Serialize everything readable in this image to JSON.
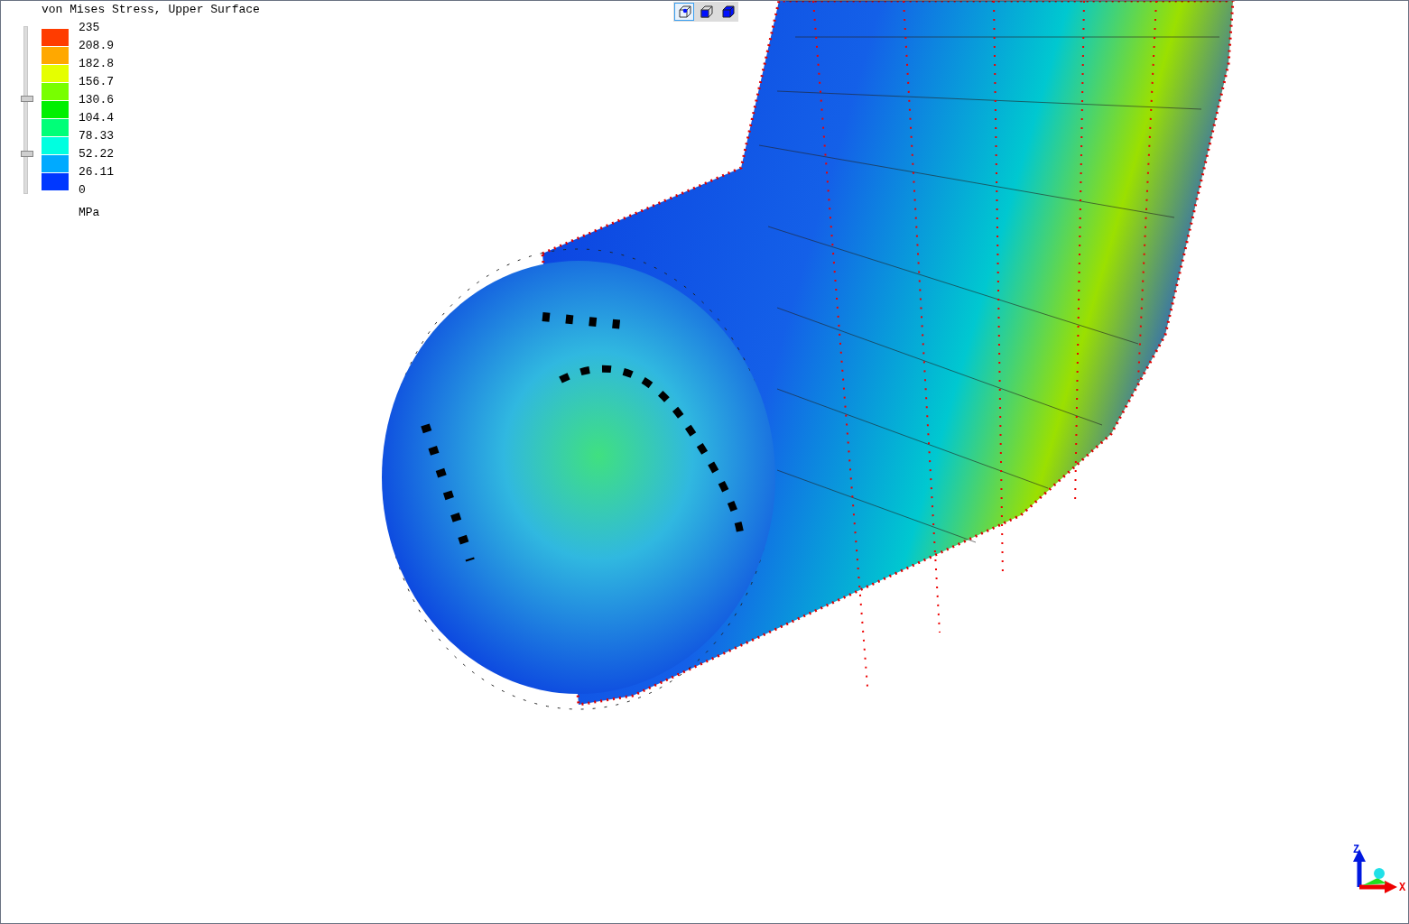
{
  "legend": {
    "title": "von Mises Stress, Upper Surface",
    "unit": "MPa",
    "bands": [
      {
        "color": "#ff3c00"
      },
      {
        "color": "#ffa800"
      },
      {
        "color": "#e5ff00"
      },
      {
        "color": "#78ff00"
      },
      {
        "color": "#00f000"
      },
      {
        "color": "#00ff78"
      },
      {
        "color": "#00ffe0"
      },
      {
        "color": "#00aaff"
      },
      {
        "color": "#0038ff"
      }
    ],
    "values": [
      "235",
      "208.9",
      "182.8",
      "156.7",
      "130.6",
      "104.4",
      "78.33",
      "52.22",
      "26.11",
      "0"
    ],
    "slider_handles": [
      {
        "level": 0.57
      },
      {
        "level": 0.24
      }
    ]
  },
  "view_buttons": [
    {
      "kind": "wireframe",
      "selected": true
    },
    {
      "kind": "shaded",
      "selected": false
    },
    {
      "kind": "solid",
      "selected": false
    }
  ],
  "axes": {
    "z_label": "Z",
    "x_label": "X"
  }
}
